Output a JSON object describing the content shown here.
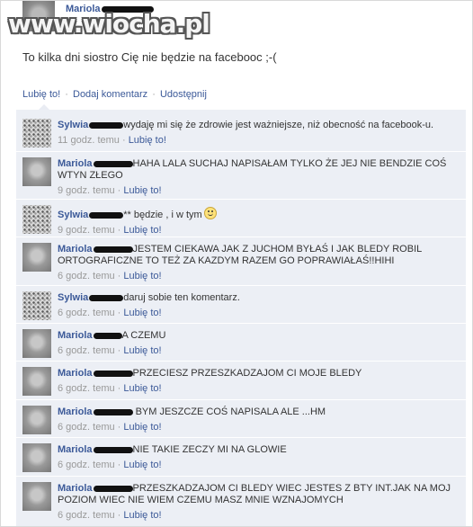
{
  "post": {
    "author": "Mariola",
    "watermark": "www.wiocha.pl",
    "text": "To kilka dni siostro Cię nie będzie na facebooc ;-("
  },
  "actions": {
    "like": "Lubię to!",
    "comment": "Dodaj komentarz",
    "share": "Udostępnij",
    "separator": "·"
  },
  "comments": [
    {
      "name": "Sylwia",
      "text": "wydaję mi się że zdrowie jest ważniejsze, niż obecność na facebook-u.",
      "time": "11 godz. temu",
      "like": "Lubię to!"
    },
    {
      "name": "Mariola",
      "text": "HAHA LALA SUCHAJ NAPISAŁAM TYLKO ŻE JEJ NIE BENDZIE COŚ WTYN ZŁEGO",
      "time": "9 godz. temu",
      "like": "Lubię to!"
    },
    {
      "name": "Sylwia",
      "text": "** będzie , i w tym",
      "time": "9 godz. temu",
      "like": "Lubię to!",
      "emoticon": "smile-icon"
    },
    {
      "name": "Mariola",
      "text": "JESTEM CIEKAWA JAK Z JUCHOM BYŁAŚ I JAK BLEDY ROBIL ORTOGRAFICZNE TO TEŻ ZA KAZDYM RAZEM GO POPRAWIAŁAŚ!!HIHI",
      "time": "6 godz. temu",
      "like": "Lubię to!"
    },
    {
      "name": "Sylwia",
      "text": "daruj sobie ten komentarz.",
      "time": "6 godz. temu",
      "like": "Lubię to!"
    },
    {
      "name": "Mariola",
      "text": "A CZEMU",
      "time": "6 godz. temu",
      "like": "Lubię to!"
    },
    {
      "name": "Mariola",
      "text": "PRZECIESZ PRZESZKADZAJOM CI MOJE BLEDY",
      "time": "6 godz. temu",
      "like": "Lubię to!"
    },
    {
      "name": "Mariola",
      "text": "BYM JESZCZE COŚ NAPISALA ALE ...HM",
      "time": "6 godz. temu",
      "like": "Lubię to!"
    },
    {
      "name": "Mariola",
      "text": "NIE TAKIE ZECZY MI NA GLOWIE",
      "time": "6 godz. temu",
      "like": "Lubię to!"
    },
    {
      "name": "Mariola",
      "text": "PRZESZKADZAJOM CI BLEDY WIEC JESTES Z BTY INT.JAK NA MOJ POZIOM WIEC NIE WIEM CZEMU MASZ MNIE WZNAJOMYCH",
      "time": "6 godz. temu",
      "like": "Lubię to!"
    }
  ],
  "colors": {
    "link": "#3b5998",
    "comment_bg": "#eceff5",
    "muted": "#999999"
  }
}
